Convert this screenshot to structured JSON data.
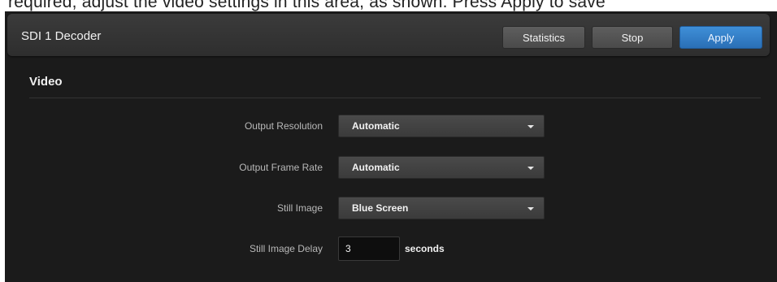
{
  "top_fragment": "required, adjust the video settings in this area, as shown. Press Apply to save",
  "header": {
    "title": "SDI 1 Decoder",
    "buttons": {
      "statistics": "Statistics",
      "stop": "Stop",
      "apply": "Apply"
    }
  },
  "section": {
    "title": "Video"
  },
  "fields": {
    "output_resolution": {
      "label": "Output Resolution",
      "value": "Automatic"
    },
    "output_frame_rate": {
      "label": "Output Frame Rate",
      "value": "Automatic"
    },
    "still_image": {
      "label": "Still Image",
      "value": "Blue Screen"
    },
    "still_image_delay": {
      "label": "Still Image Delay",
      "value": "3",
      "unit": "seconds"
    }
  },
  "colors": {
    "panel_bg": "#1b1b1b",
    "header_bg": "#353535",
    "button_gray": "#545454",
    "button_blue": "#3380c8",
    "input_bg": "#0e0e0e"
  },
  "icons": {
    "select_caret": "caret-down-icon"
  }
}
